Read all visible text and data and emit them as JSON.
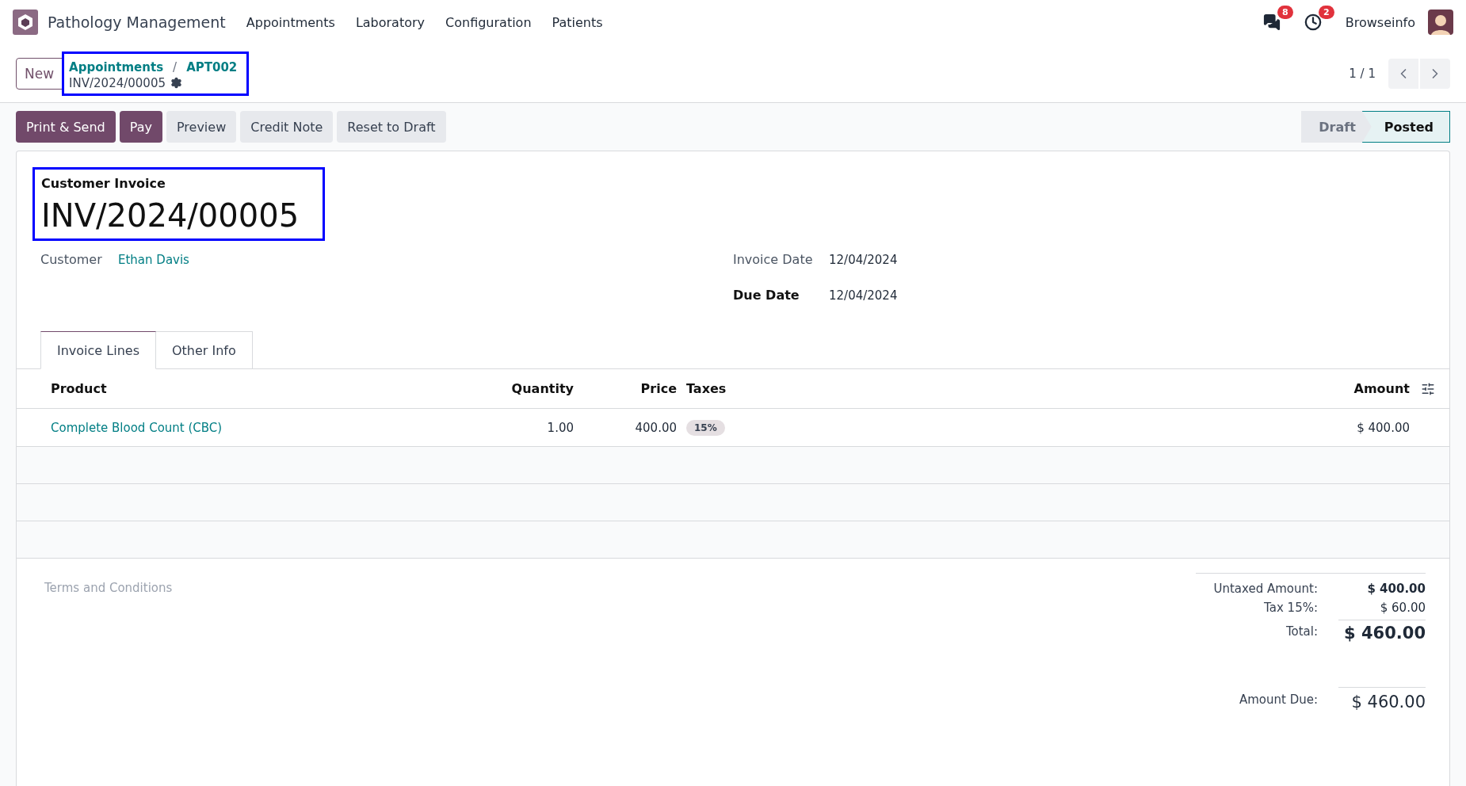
{
  "navbar": {
    "app_name": "Pathology Management",
    "menu": [
      "Appointments",
      "Laboratory",
      "Configuration",
      "Patients"
    ],
    "messages_badge": "8",
    "activities_badge": "2",
    "user": "Browseinfo"
  },
  "control_panel": {
    "new_button": "New",
    "breadcrumbs": [
      "Appointments",
      "APT002"
    ],
    "breadcrumb_separator": "/",
    "record": "INV/2024/00005",
    "pager": "1 / 1"
  },
  "actions": [
    {
      "label": "Print & Send",
      "kind": "primary"
    },
    {
      "label": "Pay",
      "kind": "primary"
    },
    {
      "label": "Preview",
      "kind": "secondary"
    },
    {
      "label": "Credit Note",
      "kind": "secondary"
    },
    {
      "label": "Reset to Draft",
      "kind": "secondary"
    }
  ],
  "status_bar": [
    {
      "label": "Draft",
      "selected": false
    },
    {
      "label": "Posted",
      "selected": true
    }
  ],
  "form": {
    "type_label": "Customer Invoice",
    "number": "INV/2024/00005",
    "customer_label": "Customer",
    "customer": "Ethan Davis",
    "invoice_date_label": "Invoice Date",
    "invoice_date": "12/04/2024",
    "due_date_label": "Due Date",
    "due_date": "12/04/2024"
  },
  "tabs": [
    {
      "label": "Invoice Lines",
      "selected": true
    },
    {
      "label": "Other Info",
      "selected": false
    }
  ],
  "table": {
    "columns": [
      "Product",
      "Quantity",
      "Price",
      "Taxes",
      "Amount"
    ],
    "rows": [
      {
        "product": "Complete Blood Count (CBC)",
        "quantity": "1.00",
        "price": "400.00",
        "taxes": "15%",
        "amount": "$ 400.00"
      }
    ]
  },
  "terms_placeholder": "Terms and Conditions",
  "totals": [
    {
      "label": "Untaxed Amount:",
      "value": "$ 400.00",
      "kind": "subtotal"
    },
    {
      "label": "Tax 15%:",
      "value": "$ 60.00",
      "kind": "tax"
    },
    {
      "label": "Total:",
      "value": "$ 460.00",
      "kind": "total"
    },
    {
      "label": "Amount Due:",
      "value": "$ 460.00",
      "kind": "due"
    }
  ]
}
